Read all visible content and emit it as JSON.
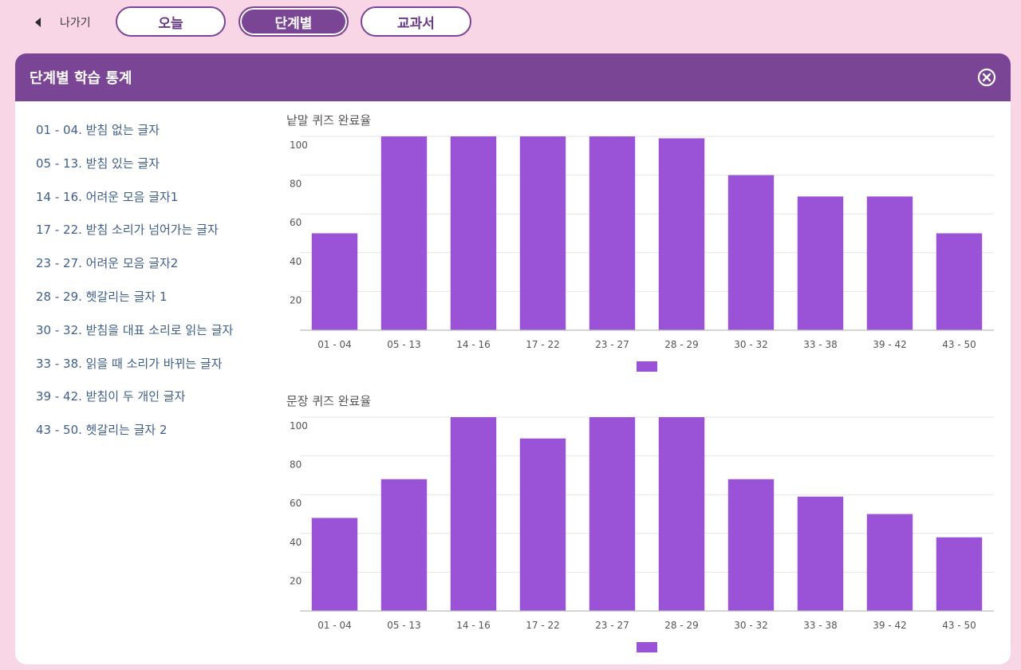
{
  "nav": {
    "back_label": "나가기",
    "tabs": [
      {
        "label": "오늘",
        "active": false
      },
      {
        "label": "단계별",
        "active": true
      },
      {
        "label": "교과서",
        "active": false
      }
    ]
  },
  "panel": {
    "title": "단계별 학습 통계",
    "close_icon": "close-circle-icon"
  },
  "stages": [
    "01 - 04. 받침 없는 글자",
    "05 - 13. 받침 있는 글자",
    "14 - 16. 어려운 모음 글자1",
    "17 - 22. 받침 소리가 넘어가는 글자",
    "23 - 27. 어려운 모음 글자2",
    "28 - 29. 헷갈리는 글자 1",
    "30 - 32. 받침을 대표 소리로 읽는 글자",
    "33 - 38. 읽을 때 소리가 바뀌는 글자",
    "39 - 42. 받침이 두 개인 글자",
    "43 - 50. 헷갈리는 글자 2"
  ],
  "colors": {
    "accent": "#7b4596",
    "bar": "#9a52d6",
    "background": "#f8d6e6",
    "list_text": "#3f5f8a"
  },
  "chart_data": [
    {
      "type": "bar",
      "title": "낱말 퀴즈 완료율",
      "categories": [
        "01 - 04",
        "05 - 13",
        "14 - 16",
        "17 - 22",
        "23 - 27",
        "28 - 29",
        "30 - 32",
        "33 - 38",
        "39 - 42",
        "43 - 50"
      ],
      "values": [
        50,
        100,
        100,
        100,
        100,
        99,
        80,
        69,
        69,
        50
      ],
      "ylim": [
        0,
        100
      ],
      "yticks": [
        20,
        40,
        60,
        80,
        100
      ],
      "grid": true,
      "legend": "bottom"
    },
    {
      "type": "bar",
      "title": "문장 퀴즈 완료율",
      "categories": [
        "01 - 04",
        "05 - 13",
        "14 - 16",
        "17 - 22",
        "23 - 27",
        "28 - 29",
        "30 - 32",
        "33 - 38",
        "39 - 42",
        "43 - 50"
      ],
      "values": [
        48,
        68,
        100,
        89,
        100,
        100,
        68,
        59,
        50,
        38
      ],
      "ylim": [
        0,
        100
      ],
      "yticks": [
        20,
        40,
        60,
        80,
        100
      ],
      "grid": true,
      "legend": "bottom"
    }
  ]
}
